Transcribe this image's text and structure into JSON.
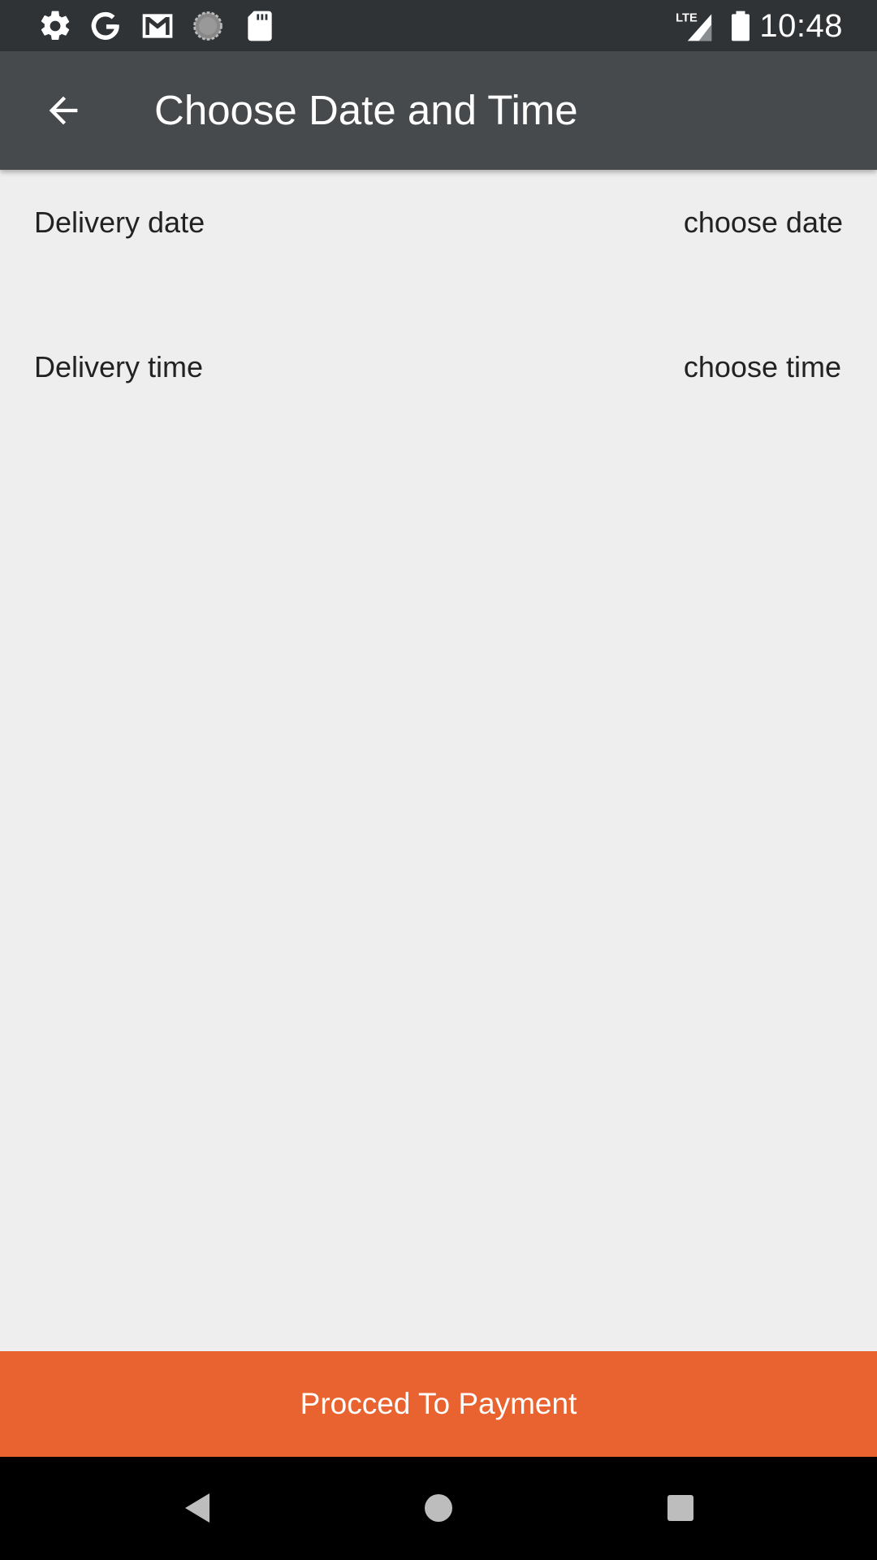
{
  "status_bar": {
    "time": "10:48",
    "left_icons": [
      "settings-gear-icon",
      "google-g-icon",
      "gmail-icon",
      "sync-circle-icon",
      "sd-card-icon"
    ],
    "right_icons": [
      "lte-signal-icon",
      "battery-icon"
    ],
    "network_label": "LTE"
  },
  "app_bar": {
    "title": "Choose Date and Time",
    "back_icon": "arrow-back-icon"
  },
  "form": {
    "date_row": {
      "label": "Delivery date",
      "action": "choose date"
    },
    "time_row": {
      "label": "Delivery time",
      "action": "choose time"
    }
  },
  "footer": {
    "proceed_label": "Procced To Payment"
  },
  "nav_bar": {
    "buttons": [
      "back-triangle-icon",
      "home-circle-icon",
      "recents-square-icon"
    ]
  },
  "colors": {
    "status_bar": "#2f3336",
    "app_bar": "#464a4d",
    "background": "#eeeeee",
    "accent": "#e96330",
    "nav_bar": "#000000"
  }
}
